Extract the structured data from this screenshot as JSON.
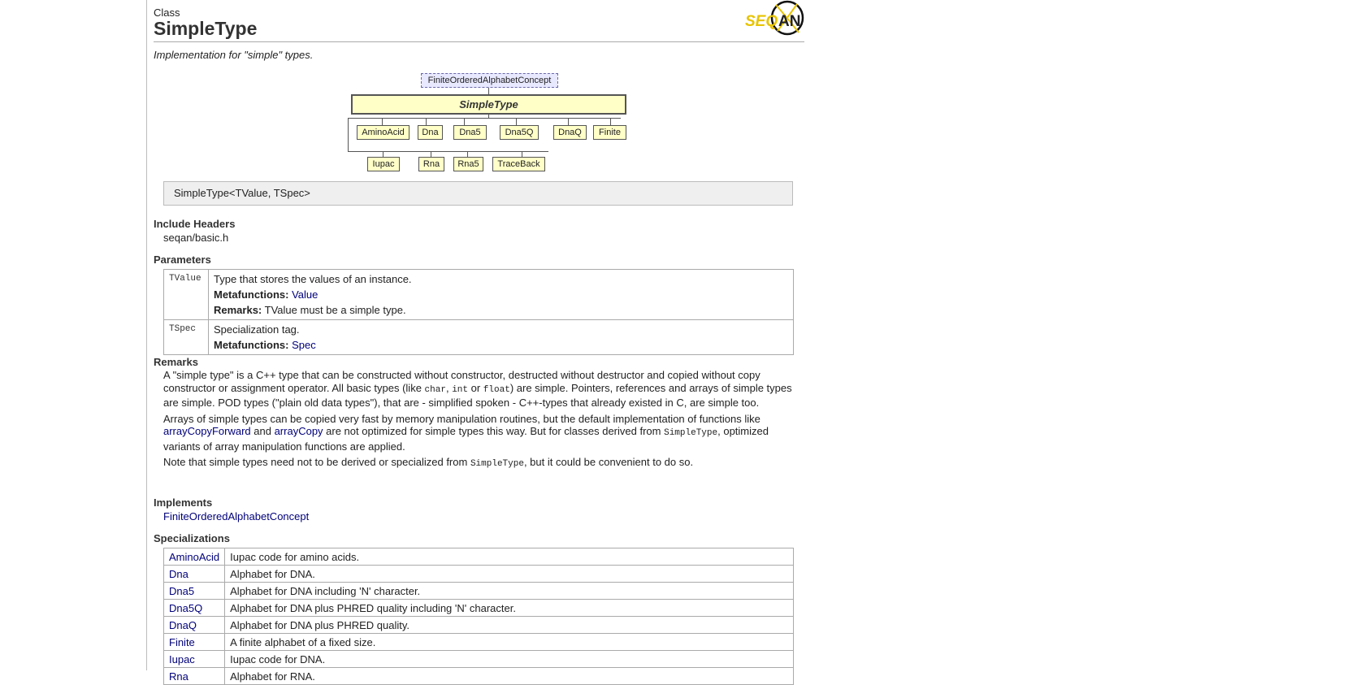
{
  "header": {
    "kind": "Class",
    "title": "SimpleType",
    "logo_text_left": "SEQ",
    "logo_text_right": "AN",
    "description": "Implementation for \"simple\" types."
  },
  "diagram": {
    "concept": "FiniteOrderedAlphabetConcept",
    "main": "SimpleType",
    "row1": [
      "AminoAcid",
      "Dna",
      "Dna5",
      "Dna5Q",
      "DnaQ",
      "Finite"
    ],
    "row2": [
      "Iupac",
      "Rna",
      "Rna5",
      "TraceBack"
    ]
  },
  "signature": "SimpleType<TValue, TSpec>",
  "include": {
    "heading": "Include Headers",
    "value": "seqan/basic.h"
  },
  "parameters": {
    "heading": "Parameters",
    "metafunctions_label": "Metafunctions:",
    "remarks_label": "Remarks:",
    "items": [
      {
        "name": "TValue",
        "desc": "Type that stores the values of an instance.",
        "metafunction": "Value",
        "remarks": "TValue must be a simple type."
      },
      {
        "name": "TSpec",
        "desc": "Specialization tag.",
        "metafunction": "Spec"
      }
    ]
  },
  "remarks": {
    "heading": "Remarks",
    "p1_a": "A \"simple type\" is a C++ type that can be constructed without constructor, destructed without destructor and copied without copy constructor or assignment operator. All basic types (like ",
    "p1_code1": "char",
    "p1_b": ", ",
    "p1_code2": "int",
    "p1_c": " or ",
    "p1_code3": "float",
    "p1_d": ") are simple. Pointers, references and arrays of simple types are simple. POD types (\"plain old data types\"), that are - simplified spoken - C++-types that already existed in C, are simple too.",
    "p2_a": "Arrays of simple types can be copied very fast by memory manipulation routines, but the default implementation of functions like ",
    "p2_link1": "arrayCopyForward",
    "p2_b": " and ",
    "p2_link2": "arrayCopy",
    "p2_c": " are not optimized for simple types this way. But for classes derived from ",
    "p2_code": "SimpleType",
    "p2_d": ", optimized variants of array manipulation functions are applied.",
    "p3_a": "Note that simple types need not to be derived or specialized from ",
    "p3_code": "SimpleType",
    "p3_b": ", but it could be convenient to do so."
  },
  "implements": {
    "heading": "Implements",
    "value": "FiniteOrderedAlphabetConcept"
  },
  "specializations": {
    "heading": "Specializations",
    "rows": [
      {
        "name": "AminoAcid",
        "desc": "Iupac code for amino acids."
      },
      {
        "name": "Dna",
        "desc": "Alphabet for DNA."
      },
      {
        "name": "Dna5",
        "desc": "Alphabet for DNA including 'N' character."
      },
      {
        "name": "Dna5Q",
        "desc": "Alphabet for DNA plus PHRED quality including 'N' character."
      },
      {
        "name": "DnaQ",
        "desc": "Alphabet for DNA plus PHRED quality."
      },
      {
        "name": "Finite",
        "desc": "A finite alphabet of a fixed size."
      },
      {
        "name": "Iupac",
        "desc": "Iupac code for DNA."
      },
      {
        "name": "Rna",
        "desc": "Alphabet for RNA."
      }
    ]
  }
}
